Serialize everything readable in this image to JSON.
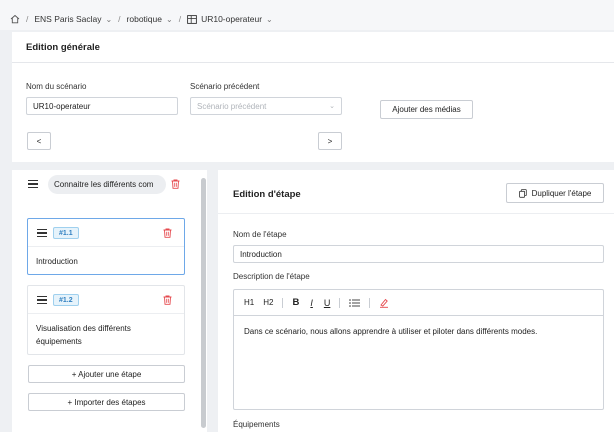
{
  "breadcrumb": {
    "items": [
      {
        "label": "ENS Paris Saclay"
      },
      {
        "label": "robotique"
      },
      {
        "label": "UR10-operateur"
      }
    ]
  },
  "edition": {
    "title": "Edition générale",
    "scenario_name_label": "Nom du scénario",
    "scenario_name_value": "UR10-operateur",
    "previous_label": "Scénario précédent",
    "previous_placeholder": "Scénario précédent",
    "add_media_label": "Ajouter des médias",
    "prev_btn": "<",
    "next_btn": ">"
  },
  "steps": {
    "chapter_label": "Connaitre les différents com",
    "items": [
      {
        "badge": "#1.1",
        "title": "Introduction",
        "active": true
      },
      {
        "badge": "#1.2",
        "title": "Visualisation des différents équipements",
        "active": false
      }
    ],
    "add_step_label": "+ Ajouter une étape",
    "import_steps_label": "+ Importer des étapes"
  },
  "step_editor": {
    "title": "Edition d'étape",
    "duplicate_label": "Dupliquer l'étape",
    "name_label": "Nom de l'étape",
    "name_value": "Introduction",
    "description_label": "Description de l'étape",
    "toolbar": {
      "h1": "H1",
      "h2": "H2",
      "bold": "B",
      "italic": "I",
      "underline": "U"
    },
    "description_text": "Dans ce scénario, nous allons apprendre à utiliser et piloter dans différents modes.",
    "equipments_label": "Équipements"
  },
  "colors": {
    "accent": "#2f7fc0",
    "danger": "#e5484d",
    "active_border": "#6ea8e8"
  }
}
